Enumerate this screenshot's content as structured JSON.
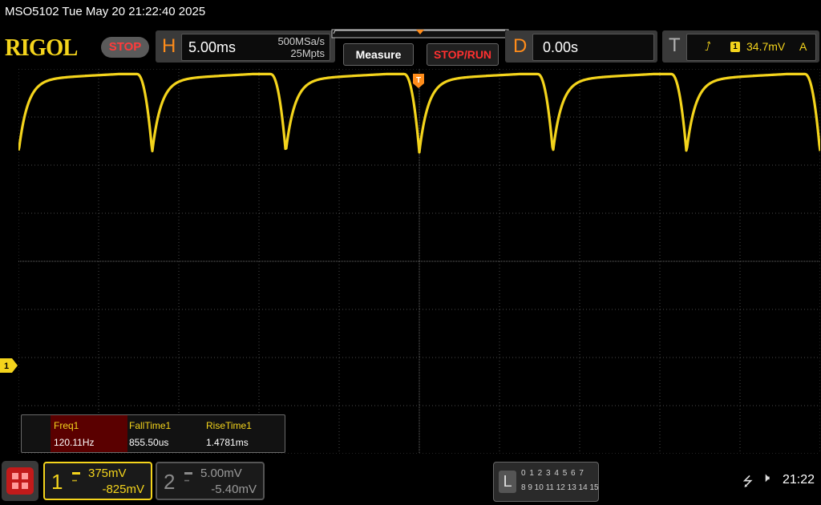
{
  "window": {
    "title": "MSO5102  Tue May 20 21:22:40 2025"
  },
  "header": {
    "brand": "RIGOL",
    "run_status": "STOP",
    "horizontal": {
      "letter": "H",
      "timebase": "5.00ms",
      "sample_rate": "500MSa/s",
      "memory_depth": "25Mpts"
    },
    "measure_label": "Measure",
    "stoprun_label": "STOP/RUN",
    "delay": {
      "letter": "D",
      "value": "0.00s"
    },
    "trigger": {
      "letter": "T",
      "source": "1",
      "level": "34.7mV",
      "mode": "A"
    }
  },
  "markers": {
    "channel1": "1"
  },
  "measurements": {
    "headers": [
      "Freq1",
      "FallTime1",
      "RiseTime1"
    ],
    "values": [
      "120.11Hz",
      "855.50us",
      "1.4781ms"
    ]
  },
  "channels": [
    {
      "number": "1",
      "scale": "375mV",
      "offset": "-825mV",
      "active": true,
      "color": "#f4d41c"
    },
    {
      "number": "2",
      "scale": "5.00mV",
      "offset": "-5.40mV",
      "active": false,
      "color": "#8a8a8a"
    }
  ],
  "logic_analyzer": {
    "letter": "L",
    "row1": "0 1 2 3   4 5 6 7",
    "row2": "8  9 10 11  12 13 14 15"
  },
  "status": {
    "clock": "21:22"
  },
  "chart_data": {
    "type": "line",
    "title": "",
    "xlabel": "",
    "ylabel": "",
    "grid": true,
    "x_units": "ms",
    "y_units": "mV",
    "xlim": [
      -25,
      25
    ],
    "ylim": [
      -1500,
      1500
    ],
    "series": [
      {
        "color": "#f4d41c",
        "period_ms": 8.33,
        "dip_times_ms": [
          -16.67,
          -8.33,
          0,
          8.33,
          16.67
        ],
        "high_level_mV": 1460,
        "low_level_mV": 850
      }
    ]
  }
}
